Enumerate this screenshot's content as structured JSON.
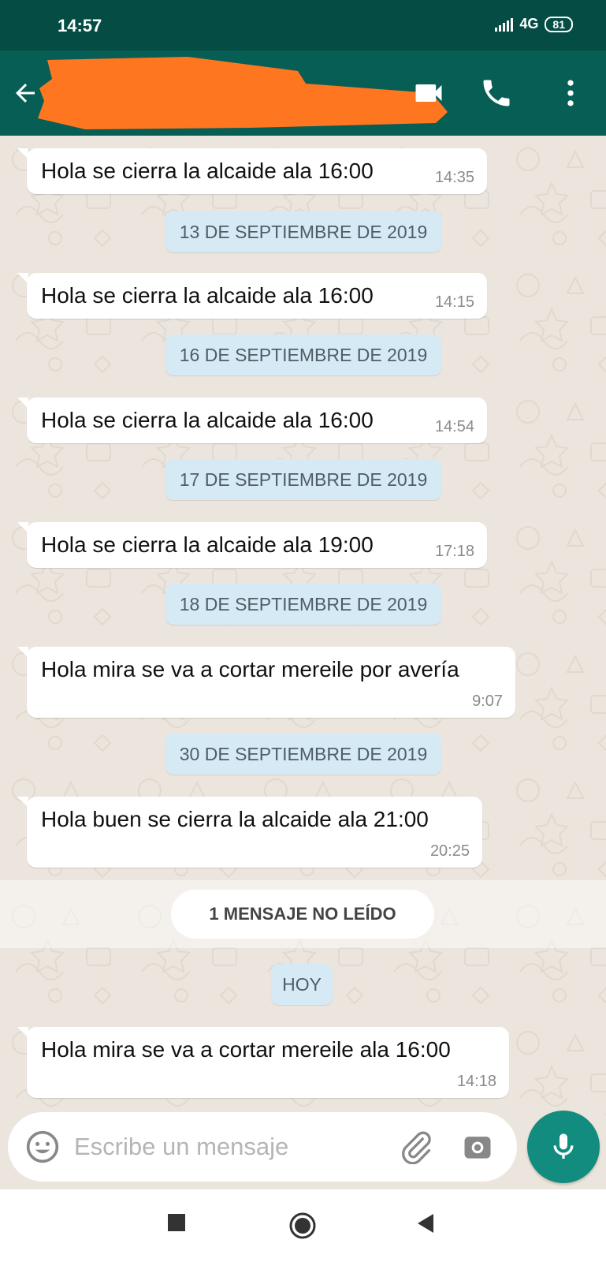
{
  "status_bar": {
    "time": "14:57",
    "network": "4G",
    "battery": "81"
  },
  "header": {
    "contact_name": ""
  },
  "chat": {
    "messages": [
      {
        "text": "Hola se cierra la alcaide ala 16:00",
        "time": "14:35"
      },
      {
        "text": "Hola se cierra la alcaide ala 16:00",
        "time": "14:15"
      },
      {
        "text": "Hola se cierra la alcaide ala 16:00",
        "time": "14:54"
      },
      {
        "text": "Hola se cierra la alcaide ala 19:00",
        "time": "17:18"
      },
      {
        "text": "Hola mira se va a cortar mereile por avería",
        "time": "9:07"
      },
      {
        "text": "Hola buen se cierra la alcaide ala 21:00",
        "time": "20:25"
      },
      {
        "text": "Hola mira se va a cortar mereile ala 16:00",
        "time": "14:18"
      }
    ],
    "date_separators": [
      "13 DE SEPTIEMBRE DE 2019",
      "16 DE SEPTIEMBRE DE 2019",
      "17 DE SEPTIEMBRE DE 2019",
      "18 DE SEPTIEMBRE DE 2019",
      "30 DE SEPTIEMBRE DE 2019",
      "HOY"
    ],
    "unread_label": "1 MENSAJE NO LEÍDO"
  },
  "composer": {
    "placeholder": "Escribe un mensaje"
  },
  "colors": {
    "header": "#075e54",
    "status_bar": "#054d44",
    "accent": "#128c7e",
    "chat_background": "#ece5dd",
    "date_pill": "#d6eaf5",
    "redaction": "#ff7621"
  },
  "icons": [
    "back-arrow-icon",
    "video-call-icon",
    "phone-icon",
    "more-options-icon",
    "emoji-icon",
    "attach-icon",
    "camera-icon",
    "mic-icon",
    "nav-recents-icon",
    "nav-home-icon",
    "nav-back-icon"
  ]
}
